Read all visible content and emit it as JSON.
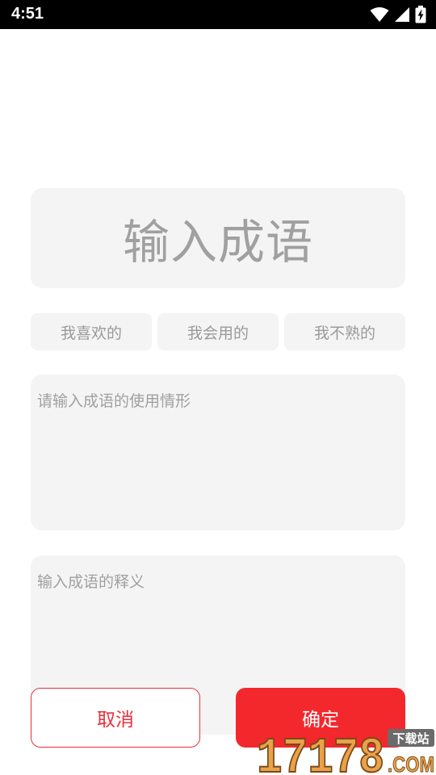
{
  "status_bar": {
    "time": "4:51",
    "icons": [
      "wifi-icon",
      "cellular-signal-icon",
      "battery-charging-icon"
    ]
  },
  "form": {
    "idiom_placeholder": "输入成语",
    "tabs": [
      {
        "label": "我喜欢的"
      },
      {
        "label": "我会用的"
      },
      {
        "label": "我不熟的"
      }
    ],
    "usage_placeholder": "请输入成语的使用情形",
    "meaning_placeholder": "输入成语的释义"
  },
  "actions": {
    "cancel_label": "取消",
    "confirm_label": "确定"
  },
  "watermark": {
    "number": "17178",
    "badge": "下载站",
    "suffix": ".COM"
  },
  "colors": {
    "accent": "#f3282c",
    "cancel_border": "#e8303a",
    "field_bg": "#f4f4f4",
    "placeholder": "#a0a0a0",
    "watermark_orange": "#e9a24a"
  }
}
